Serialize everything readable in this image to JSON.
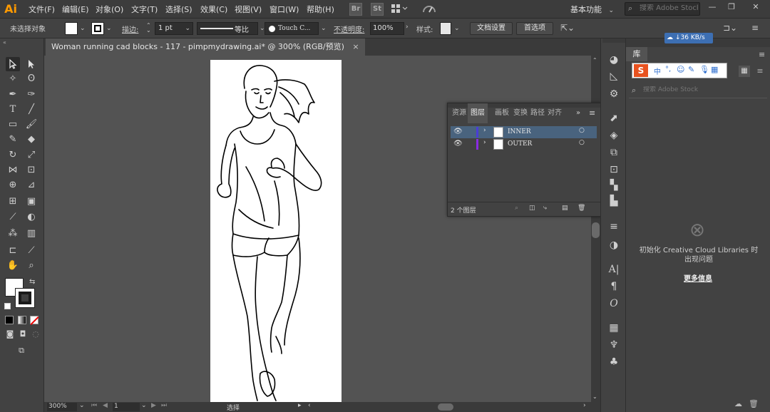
{
  "app": {
    "logo": "Ai"
  },
  "menu": {
    "items": [
      "文件(F)",
      "编辑(E)",
      "对象(O)",
      "文字(T)",
      "选择(S)",
      "效果(C)",
      "视图(V)",
      "窗口(W)",
      "帮助(H)"
    ],
    "bridge_label": "Br",
    "stock_label": "St",
    "workspace": "基本功能",
    "search_placeholder": "搜索 Adobe Stock"
  },
  "control": {
    "selection": "未选择对象",
    "stroke_label": "描边:",
    "stroke_weight": "1 pt",
    "profile_label": "等比",
    "brush_label": "Touch C...",
    "opacity_label": "不透明度:",
    "opacity_value": "100%",
    "style_label": "样式:",
    "doc_setup": "文档设置",
    "prefs": "首选项"
  },
  "cloud": {
    "speed": "↓36 KB/s"
  },
  "document": {
    "tab_title": "Woman running cad blocks - 117 - pimpmydrawing.ai* @ 300% (RGB/预览)",
    "close": "×"
  },
  "status": {
    "zoom": "300%",
    "page": "1",
    "mode": "选择"
  },
  "layers_panel": {
    "tabs": [
      "资源",
      "图层",
      "画板",
      "变换",
      "路径",
      "对齐"
    ],
    "active_tab": "图层",
    "layers": [
      {
        "name": "INNER",
        "color": "#4a3dd6"
      },
      {
        "name": "OUTER",
        "color": "#8a2be2"
      }
    ],
    "count_label": "2 个图层"
  },
  "libraries": {
    "tab": "库",
    "search_placeholder": "搜索 Adobe Stock",
    "message": "初始化 Creative Cloud Libraries 时出现问题",
    "more_info": "更多信息"
  },
  "colors": {
    "accent": "#ff9a00",
    "selection": "#49637e",
    "panel": "#424242",
    "canvas": "#535353"
  }
}
